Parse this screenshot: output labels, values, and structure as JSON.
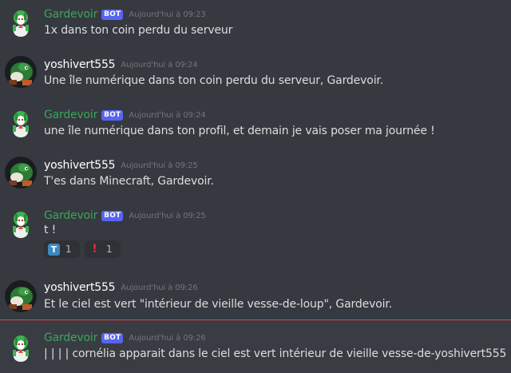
{
  "messages": [
    {
      "author": "Gardevoir",
      "bot_tag": "BOT",
      "timestamp": "Aujourd'hui à 09:23",
      "text": "1x dans ton coin perdu du serveur"
    },
    {
      "author": "yoshivert555",
      "timestamp": "Aujourd'hui à 09:24",
      "text": "Une île numérique dans ton coin perdu du serveur, Gardevoir."
    },
    {
      "author": "Gardevoir",
      "bot_tag": "BOT",
      "timestamp": "Aujourd'hui à 09:24",
      "text": "une île numérique dans ton profil, et demain je vais poser ma journée !"
    },
    {
      "author": "yoshivert555",
      "timestamp": "Aujourd'hui à 09:25",
      "text": "T'es dans Minecraft, Gardevoir."
    },
    {
      "author": "Gardevoir",
      "bot_tag": "BOT",
      "timestamp": "Aujourd'hui à 09:25",
      "text": "t !",
      "reactions": [
        {
          "emoji": "T",
          "icon": "regional-indicator-t-icon",
          "count": "1"
        },
        {
          "emoji": "!",
          "icon": "exclamation-icon",
          "count": "1"
        }
      ]
    },
    {
      "author": "yoshivert555",
      "timestamp": "Aujourd'hui à 09:26",
      "text": "Et le ciel est vert \"intérieur de vieille vesse-de-loup\", Gardevoir."
    },
    {
      "author": "Gardevoir",
      "bot_tag": "BOT",
      "timestamp": "Aujourd'hui à 09:26",
      "text": "| | | | cornélia apparait dans le ciel est vert intérieur de vieille vesse-de-yoshivert555"
    }
  ],
  "colors": {
    "background": "#36393f",
    "bot_name": "#3ba55c",
    "bot_tag": "#5865f2",
    "new_message_divider": "#ed4245"
  }
}
